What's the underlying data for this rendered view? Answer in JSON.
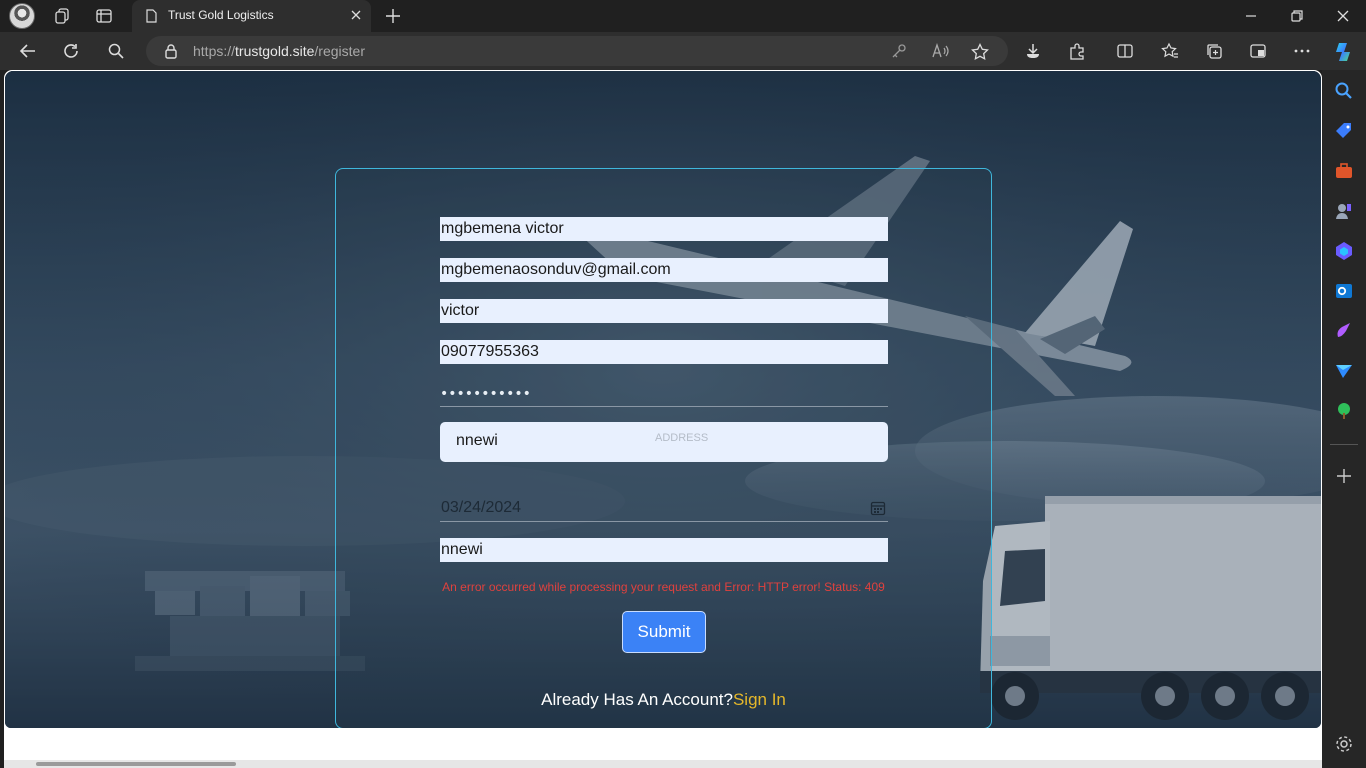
{
  "browser": {
    "tab_title": "Trust Gold Logistics",
    "url_scheme": "https://",
    "url_host": "trustgold.site",
    "url_path": "/register"
  },
  "form": {
    "full_name": "mgbemena victor",
    "email": "mgbemenaosonduv@gmail.com",
    "username": "victor",
    "phone": "09077955363",
    "password_mask": "•••••••••••",
    "address_value": "nnewi",
    "address_label": "ADDRESS",
    "date": "03/24/2024",
    "city": "nnewi",
    "error_message": "An error occurred while processing your request and Error: HTTP error! Status: 409",
    "submit_label": "Submit",
    "account_prompt": "Already Has An Account?",
    "signin_label": "Sign In"
  },
  "colors": {
    "card_border": "#3fb7dc",
    "submit_bg": "#3b82f6",
    "error": "#e0413e",
    "link": "#e5b72a",
    "field_bg": "#e8f0fe"
  }
}
